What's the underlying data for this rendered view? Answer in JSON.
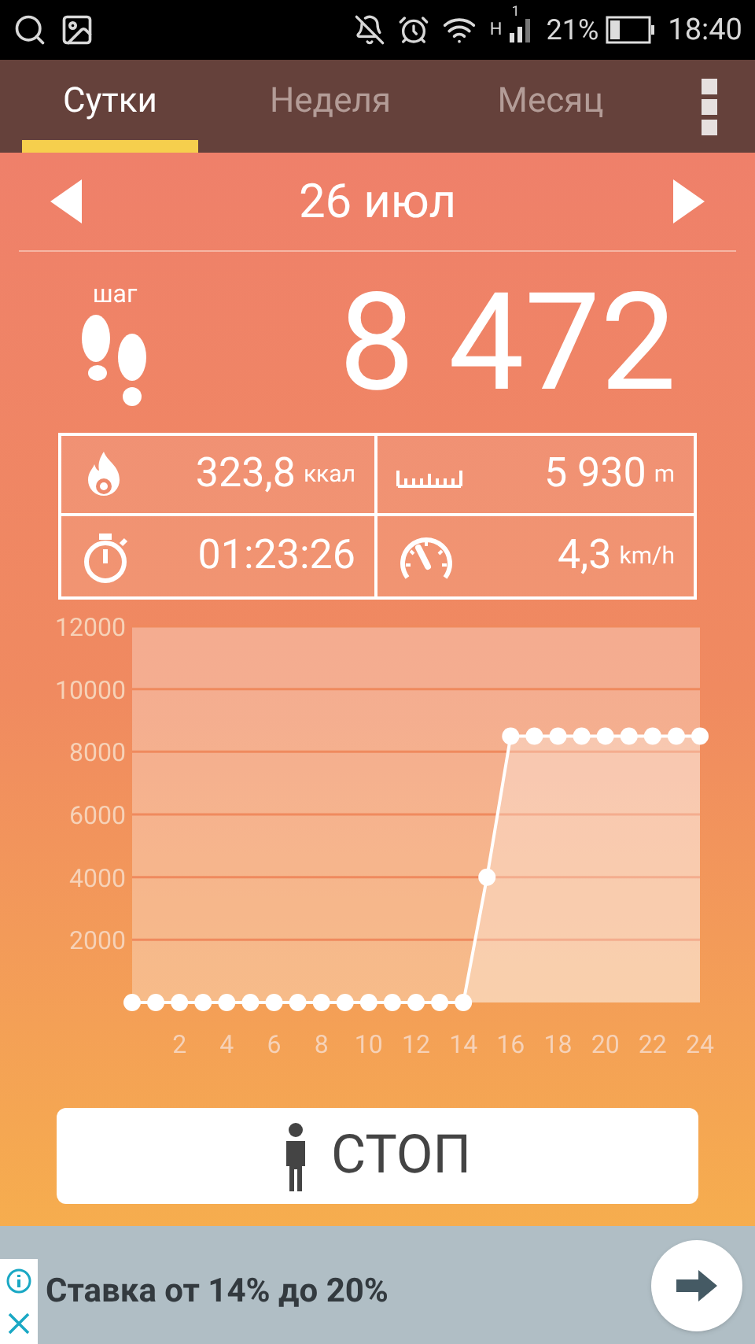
{
  "status_bar": {
    "network": "H",
    "sim": "1",
    "battery": "21%",
    "time": "18:40"
  },
  "tabs": [
    {
      "label": "Сутки",
      "selected": true
    },
    {
      "label": "Неделя",
      "selected": false
    },
    {
      "label": "Месяц",
      "selected": false
    }
  ],
  "date_nav": {
    "date": "26 июл"
  },
  "steps": {
    "unit": "шаг",
    "value": "8 472"
  },
  "stats": [
    {
      "kind": "calories",
      "value": "323,8",
      "unit": "ккал"
    },
    {
      "kind": "distance",
      "value": "5 930",
      "unit": "m"
    },
    {
      "kind": "duration",
      "value": "01:23:26"
    },
    {
      "kind": "speed",
      "value": "4,3",
      "unit": "km/h"
    }
  ],
  "chart": {
    "chart_data": {
      "type": "area",
      "x": [
        0,
        1,
        2,
        3,
        4,
        5,
        6,
        7,
        8,
        9,
        10,
        11,
        12,
        13,
        14,
        15,
        16,
        17,
        18,
        19,
        20,
        21,
        22,
        23,
        24
      ],
      "values": [
        0,
        0,
        0,
        0,
        0,
        0,
        0,
        0,
        0,
        0,
        0,
        0,
        0,
        0,
        0,
        4000,
        8500,
        8500,
        8500,
        8500,
        8500,
        8500,
        8500,
        8500,
        8500
      ],
      "grid": true,
      "xlim": [
        0,
        24
      ],
      "ylim": [
        0,
        12000
      ],
      "xticks": [
        2,
        4,
        6,
        8,
        10,
        12,
        14,
        16,
        18,
        20,
        22,
        24
      ],
      "yticks": [
        2000,
        4000,
        6000,
        8000,
        10000,
        12000
      ]
    }
  },
  "button": {
    "label": "СТОП"
  },
  "ad": {
    "text": "Ставка от 14% до 20%"
  }
}
